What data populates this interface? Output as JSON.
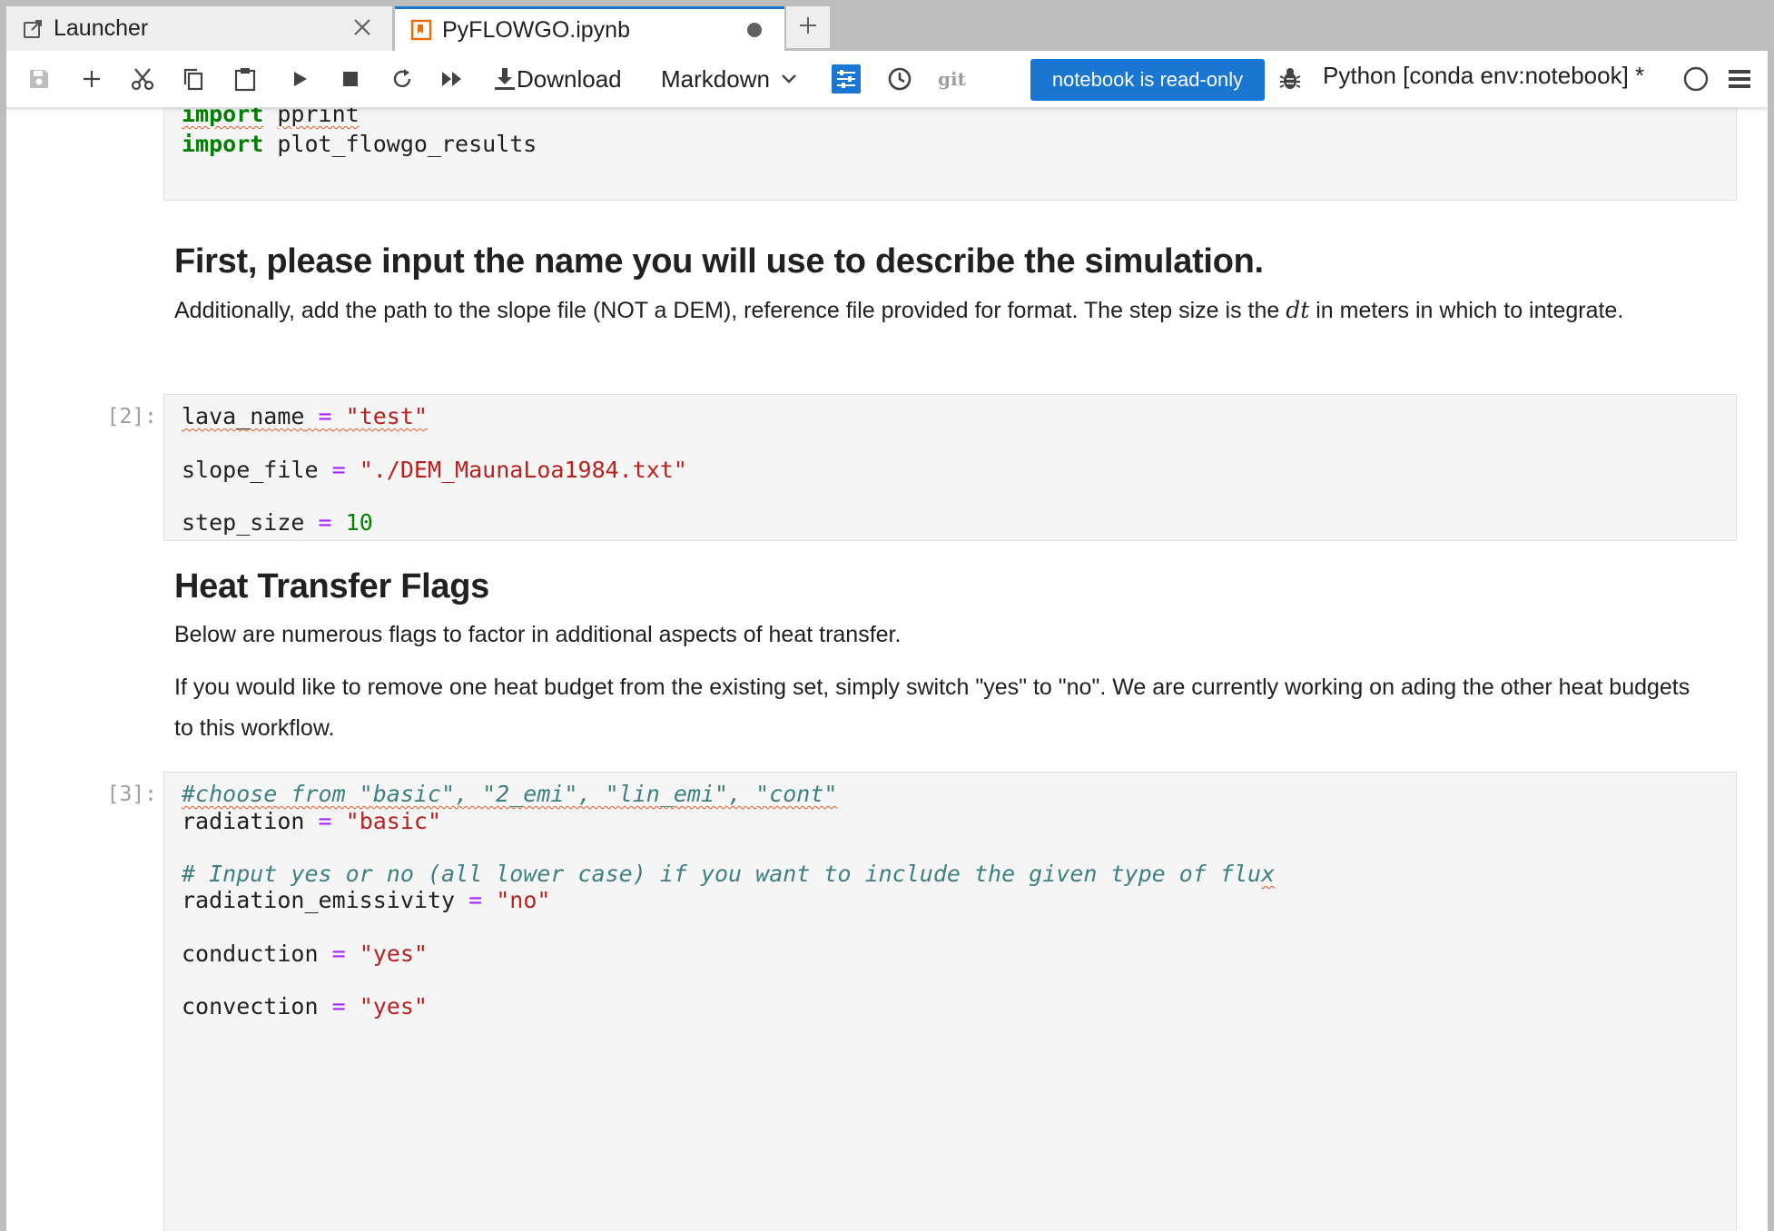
{
  "tabs": [
    {
      "label": "Launcher",
      "icon": "launch-icon",
      "active": false
    },
    {
      "label": "PyFLOWGO.ipynb",
      "icon": "notebook-icon",
      "active": true,
      "unsaved": true
    }
  ],
  "toolbar": {
    "download_label": "Download",
    "cell_type": "Markdown",
    "git_label": "git",
    "readonly_badge": "notebook is read-only",
    "kernel_name": "Python [conda env:notebook] *",
    "icons": [
      "save-icon",
      "add-cell-icon",
      "cut-icon",
      "copy-icon",
      "paste-icon",
      "run-icon",
      "stop-icon",
      "restart-icon",
      "run-all-icon",
      "download-icon",
      "property-inspector-icon",
      "history-icon",
      "debugger-icon",
      "kernel-status-icon",
      "menu-icon"
    ]
  },
  "cells": {
    "code1": {
      "line1_kw": "import",
      "line1_mod": "pprint",
      "line2_kw": "import",
      "line2_mod": "plot_flowgo_results"
    },
    "md1": {
      "heading": "First, please input the name you will use to describe the simulation.",
      "para_before_math": "Additionally, add the path to the slope file (NOT a DEM), reference file provided for format. The step size is the ",
      "math": "dt",
      "para_after_math": " in meters in which to integrate."
    },
    "code2": {
      "prompt": "[2]:",
      "var1": "lava_name",
      "val1": "\"test\"",
      "var2": "slope_file",
      "val2": "\"./DEM_MaunaLoa1984.txt\"",
      "var3": "step_size",
      "val3": "10",
      "op": "="
    },
    "md2": {
      "heading": "Heat Transfer Flags",
      "para1": "Below are numerous flags to factor in additional aspects of heat transfer.",
      "para2": "If you would like to remove one heat budget from the existing set, simply switch \"yes\" to \"no\". We are currently working on ading the other heat budgets to this workflow."
    },
    "code3": {
      "prompt": "[3]:",
      "comment1": "#choose from \"basic\", \"2_emi\", \"lin_emi\", \"cont\"",
      "var1": "radiation",
      "val1": "\"basic\"",
      "comment2_main": "# Input yes or no (all lower case) if you want to include the given type of flu",
      "comment2_tail": "x",
      "var2": "radiation_emissivity",
      "val2": "\"no\"",
      "var3": "conduction",
      "val3": "\"yes\"",
      "var4": "convection",
      "val4": "\"yes\"",
      "op": "="
    }
  }
}
